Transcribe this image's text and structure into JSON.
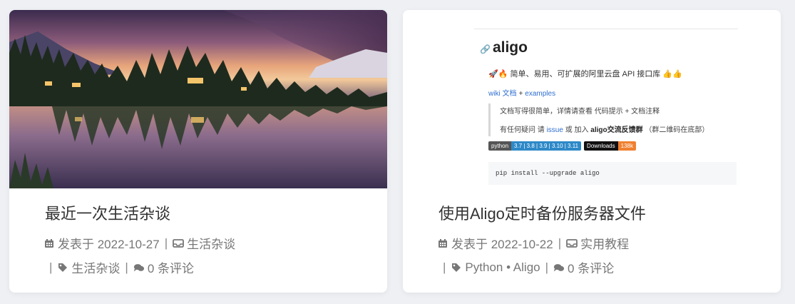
{
  "posts": [
    {
      "title": "最近一次生活杂谈",
      "date_label": "发表于 2022-10-27",
      "category": "生活杂谈",
      "tags": "生活杂谈",
      "comments": "0 条评论",
      "thumbnail": "lake-sunset-photo"
    },
    {
      "title": "使用Aligo定时备份服务器文件",
      "date_label": "发表于 2022-10-22",
      "category": "实用教程",
      "tags": "Python • Aligo",
      "comments": "0 条评论",
      "thumbnail": "aligo-readme-screenshot",
      "readme": {
        "heading_prefix": "🔗",
        "heading": "aligo",
        "emoji_left": "🚀🔥",
        "desc": "简单、易用、可扩展的阿里云盘 API 接口库",
        "emoji_right": "👍👍",
        "wiki": "wiki 文档",
        "plus": "+",
        "examples": "examples",
        "quote1": "文档写得很简单，详情请查看 代码提示 + 文档注释",
        "quote2_a": "有任何疑问 请",
        "quote2_issue": "issue",
        "quote2_b": "或 加入",
        "quote2_bold": "aligo交流反馈群",
        "quote2_c": "（群二维码在底部）",
        "badge_python_label": "python",
        "badge_python_value": "3.7 | 3.8 | 3.9 | 3.10 | 3.11",
        "badge_downloads_label": "Downloads",
        "badge_downloads_value": "138k",
        "code": "pip install --upgrade aligo"
      }
    }
  ],
  "colors": {
    "background": "#eef0f4",
    "card": "#ffffff",
    "title": "#333333",
    "meta": "#777777",
    "link_blue": "#2f6fd0",
    "badge_python_value": "#2d89c8",
    "badge_downloads_value": "#f08030"
  },
  "icons": {
    "date": "calendar-icon",
    "category": "folder-icon",
    "tag": "tag-icon",
    "comment": "comments-icon"
  },
  "separator": "|"
}
